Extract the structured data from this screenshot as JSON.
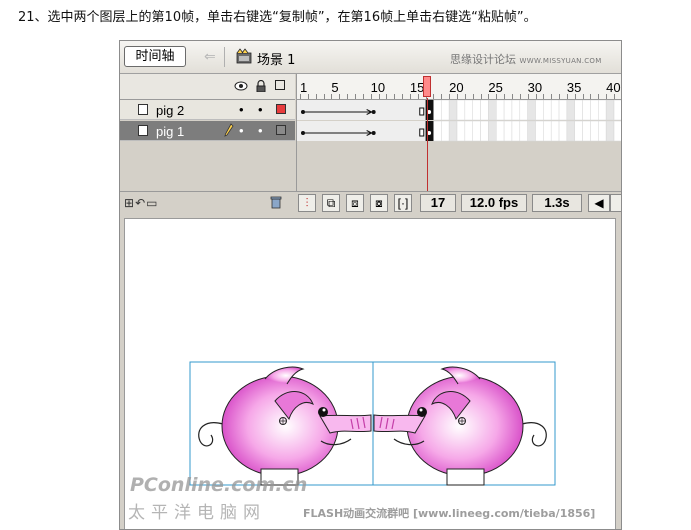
{
  "instruction": "21、选中两个图层上的第10帧，单击右键选“复制帧”，在第16帧上单击右键选“粘贴帧”。",
  "toolbar": {
    "timeline_button": "时间轴",
    "scene_label": "场景 1",
    "watermark_cn": "思缘设计论坛",
    "watermark_en": "WWW.MISSYUAN.COM"
  },
  "timeline": {
    "ruler_numbers": [
      "1",
      "5",
      "10",
      "15",
      "20",
      "25",
      "30",
      "35",
      "40"
    ],
    "current_frame_number": 17,
    "layers": [
      {
        "name": "pig 2",
        "color": "#e83c3c",
        "selected": false
      },
      {
        "name": "pig 1",
        "color": "#8a8a8a",
        "selected": true
      }
    ]
  },
  "status": {
    "frame": "17",
    "fps": "12.0 fps",
    "time": "1.3s"
  },
  "watermarks": {
    "pconline": "PConline.com.cn",
    "pconline_cn": "太平洋电脑网",
    "forum": "FLASH动画交流群吧 [www.lineeg.com/tieba/1856]"
  },
  "icons": [
    "eye-icon",
    "lock-icon",
    "outline-icon",
    "scene-icon",
    "pencil-icon",
    "trash-icon",
    "onion-skin-icon"
  ]
}
